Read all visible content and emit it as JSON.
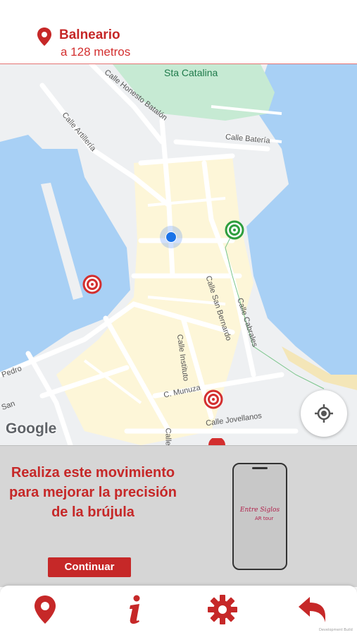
{
  "header": {
    "place_name": "Balneario",
    "distance": "a 128 metros"
  },
  "map": {
    "park_label": "Sta Catalina",
    "street_labels": {
      "honesto_batalon": "Calle Honesto Batalón",
      "artilleria": "Calle Artillería",
      "bateria": "Calle Batería",
      "san_bernardo": "Calle San Bernardo",
      "cabrales": "Calle Cabrales",
      "instituto": "Calle Instituto",
      "munuza": "C. Munuza",
      "jovellanos": "Calle Jovellanos",
      "pedro": "Pedro",
      "san": "San",
      "calle_partial": "Calle"
    },
    "attribution": "Google",
    "colors": {
      "water": "#a8d0f5",
      "land": "#eef0f2",
      "park": "#c6ead3",
      "district": "#fdf6d8",
      "target_red": "#d32f2f",
      "target_green": "#2e9e3e"
    }
  },
  "panel": {
    "message": "Realiza este movimiento para mejorar la precisión de la brújula",
    "continue_label": "Continuar",
    "phone_brand": "Entre Siglos",
    "phone_sub": "AR tour"
  },
  "nav": {
    "icons": [
      "map-pin-icon",
      "info-icon",
      "gear-icon",
      "back-arrow-icon"
    ],
    "dev_label": "Development Build"
  },
  "accent_color": "#c62828"
}
